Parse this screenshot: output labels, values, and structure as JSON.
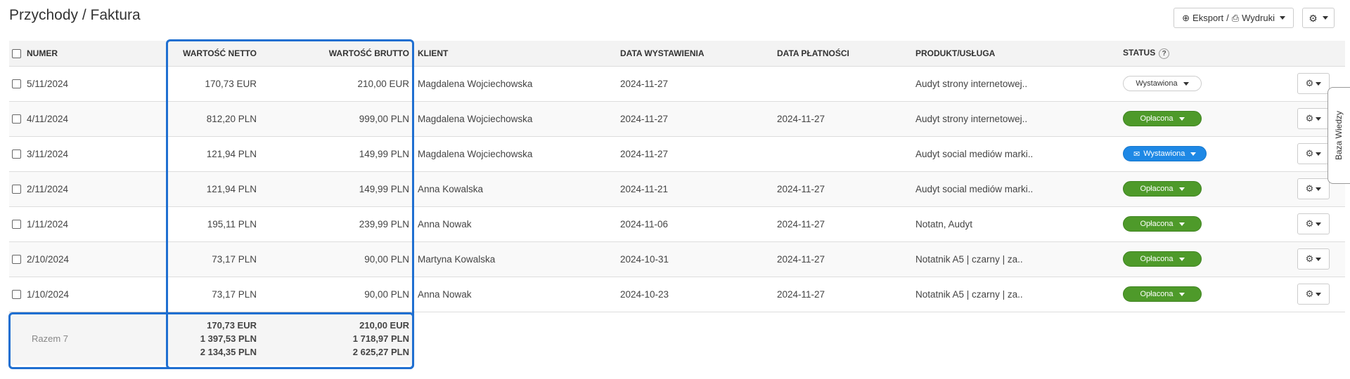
{
  "page": {
    "title": "Przychody / Faktura"
  },
  "toolbar": {
    "export_label": "Eksport",
    "separator": "/",
    "print_label": "Wydruki"
  },
  "columns": {
    "numer": "NUMER",
    "netto": "WARTOŚĆ NETTO",
    "brutto": "WARTOŚĆ BRUTTO",
    "klient": "KLIENT",
    "data_wyst": "DATA WYSTAWIENIA",
    "data_plat": "DATA PŁATNOŚCI",
    "produkt": "PRODUKT/USŁUGA",
    "status": "STATUS",
    "status_help": "?"
  },
  "rows": [
    {
      "numer": "5/11/2024",
      "netto": "170,73 EUR",
      "brutto": "210,00 EUR",
      "klient": "Magdalena Wojciechowska",
      "data_wyst": "2024-11-27",
      "data_plat": "",
      "produkt": "Audyt strony internetowej..",
      "status": "Wystawiona",
      "status_type": "issued"
    },
    {
      "numer": "4/11/2024",
      "netto": "812,20 PLN",
      "brutto": "999,00 PLN",
      "klient": "Magdalena Wojciechowska",
      "data_wyst": "2024-11-27",
      "data_plat": "2024-11-27",
      "produkt": "Audyt strony internetowej..",
      "status": "Opłacona",
      "status_type": "paid"
    },
    {
      "numer": "3/11/2024",
      "netto": "121,94 PLN",
      "brutto": "149,99 PLN",
      "klient": "Magdalena Wojciechowska",
      "data_wyst": "2024-11-27",
      "data_plat": "",
      "produkt": "Audyt social mediów marki..",
      "status": "Wystawiona",
      "status_type": "sent"
    },
    {
      "numer": "2/11/2024",
      "netto": "121,94 PLN",
      "brutto": "149,99 PLN",
      "klient": "Anna Kowalska",
      "data_wyst": "2024-11-21",
      "data_plat": "2024-11-27",
      "produkt": "Audyt social mediów marki..",
      "status": "Opłacona",
      "status_type": "paid"
    },
    {
      "numer": "1/11/2024",
      "netto": "195,11 PLN",
      "brutto": "239,99 PLN",
      "klient": "Anna Nowak",
      "data_wyst": "2024-11-06",
      "data_plat": "2024-11-27",
      "produkt": "Notatn, Audyt",
      "status": "Opłacona",
      "status_type": "paid"
    },
    {
      "numer": "2/10/2024",
      "netto": "73,17 PLN",
      "brutto": "90,00 PLN",
      "klient": "Martyna Kowalska",
      "data_wyst": "2024-10-31",
      "data_plat": "2024-11-27",
      "produkt": "Notatnik A5 | czarny | za..",
      "status": "Opłacona",
      "status_type": "paid"
    },
    {
      "numer": "1/10/2024",
      "netto": "73,17 PLN",
      "brutto": "90,00 PLN",
      "klient": "Anna Nowak",
      "data_wyst": "2024-10-23",
      "data_plat": "2024-11-27",
      "produkt": "Notatnik A5 | czarny | za..",
      "status": "Opłacona",
      "status_type": "paid"
    }
  ],
  "totals": {
    "label": "Razem 7",
    "netto": [
      "170,73 EUR",
      "1 397,53 PLN",
      "2 134,35 PLN"
    ],
    "brutto": [
      "210,00 EUR",
      "1 718,97 PLN",
      "2 625,27 PLN"
    ]
  },
  "side_tab": {
    "label": "Baza Wiedzy"
  },
  "icons": {
    "export": "export-icon",
    "print": "print-icon",
    "gear": "gear-icon",
    "mail": "mail-icon"
  },
  "colors": {
    "paid": "#4e9a2a",
    "sent": "#1e88e5",
    "highlight": "#1f6fd1"
  }
}
